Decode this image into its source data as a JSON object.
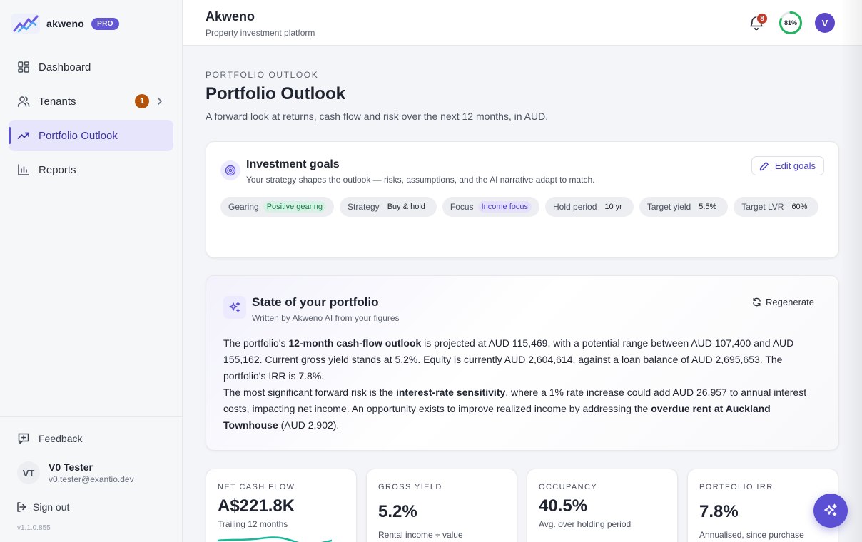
{
  "brand": {
    "name": "akweno",
    "badge": "PRO",
    "accent": "#5b4fd3"
  },
  "nav": [
    {
      "label": "Dashboard",
      "icon": "dashboard-icon"
    },
    {
      "label": "Tenants",
      "icon": "users-icon",
      "count": "1"
    },
    {
      "label": "Portfolio Outlook",
      "icon": "trending-up-icon",
      "active": true
    },
    {
      "label": "Reports",
      "icon": "bar-chart-icon"
    }
  ],
  "sidebar_footer": {
    "feedback": "Feedback",
    "user_initials": "VT",
    "user_name": "V0 Tester",
    "user_email": "v0.tester@exantio.dev",
    "sign_out": "Sign out",
    "version": "v1.1.0.855"
  },
  "header": {
    "title": "Akweno",
    "subtitle": "Property investment platform",
    "notification_count": "8",
    "progress_label": "81%",
    "progress_value": 0.81,
    "avatar_initial": "V"
  },
  "page": {
    "eyebrow": "PORTFOLIO OUTLOOK",
    "title": "Portfolio Outlook",
    "subtitle": "A forward look at returns, cash flow and risk over the next 12 months, in AUD."
  },
  "goals": {
    "title": "Investment goals",
    "subtitle": "Your strategy shapes the outlook — risks, assumptions, and the AI narrative adapt to match.",
    "edit_label": "Edit goals",
    "chips": [
      {
        "label": "Gearing",
        "value": "Positive gearing",
        "style": "green"
      },
      {
        "label": "Strategy",
        "value": "Buy & hold",
        "style": "plain"
      },
      {
        "label": "Focus",
        "value": "Income focus",
        "style": "purple"
      },
      {
        "label": "Hold period",
        "value": "10 yr",
        "style": "plain"
      },
      {
        "label": "Target yield",
        "value": "5.5%",
        "style": "plain"
      },
      {
        "label": "Target LVR",
        "value": "60%",
        "style": "plain"
      }
    ]
  },
  "state": {
    "title": "State of your portfolio",
    "subtitle": "Written by Akweno AI from your figures",
    "regenerate": "Regenerate",
    "p1_a": "The portfolio's ",
    "p1_b": "12-month cash-flow outlook",
    "p1_c": " is projected at AUD 115,469, with a potential range between AUD 107,400 and AUD 155,162. Current gross yield stands at 5.2%. Equity is currently AUD 2,604,614, against a loan balance of AUD 2,695,653. The portfolio's IRR is 7.8%.",
    "p2_a": "The most significant forward risk is the ",
    "p2_b": "interest-rate sensitivity",
    "p2_c": ", where a 1% rate increase could add AUD 26,957 to annual interest costs, impacting net income. An opportunity exists to improve realized income by addressing the ",
    "p2_d": "overdue rent at Auckland Townhouse",
    "p2_e": " (AUD 2,902)."
  },
  "kpis": [
    {
      "label": "NET CASH FLOW",
      "value": "A$221.8K",
      "note": "Trailing 12 months"
    },
    {
      "label": "GROSS YIELD",
      "value": "5.2%",
      "note": "Rental income ÷ value"
    },
    {
      "label": "OCCUPANCY",
      "value": "40.5%",
      "note": "Avg. over holding period"
    },
    {
      "label": "PORTFOLIO IRR",
      "value": "7.8%",
      "note": "Annualised, since purchase"
    }
  ]
}
